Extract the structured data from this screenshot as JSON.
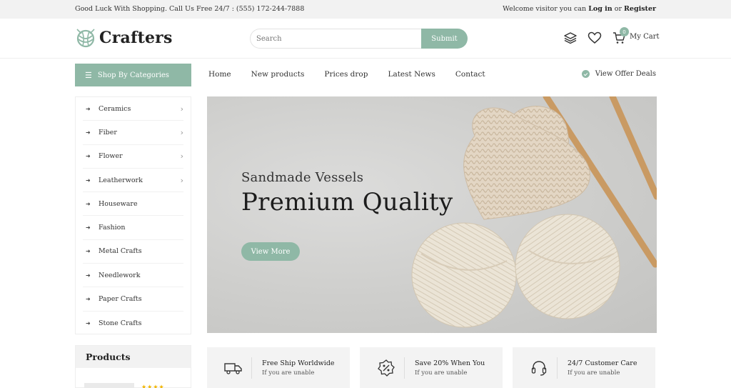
{
  "topbar": {
    "welcome_text": "Good Luck With Shopping. Call Us Free 24/7 : (555) 172-244-7888",
    "visitor_text": "Welcome visitor you can",
    "login_label": "Log in",
    "or_text": "or",
    "register_label": "Register"
  },
  "header": {
    "logo_text": "Crafters",
    "search_placeholder": "Search",
    "search_button": "Submit",
    "cart_count": "0",
    "cart_label": "My Cart"
  },
  "nav": {
    "categories_button": "Shop By Categories",
    "items": [
      "Home",
      "New products",
      "Prices drop",
      "Latest News",
      "Contact"
    ],
    "offer_label": "View Offer Deals"
  },
  "sidebar": {
    "categories": [
      {
        "label": "Ceramics",
        "has_submenu": true
      },
      {
        "label": "Fiber",
        "has_submenu": true
      },
      {
        "label": "Flower",
        "has_submenu": true
      },
      {
        "label": "Leatherwork",
        "has_submenu": true
      },
      {
        "label": "Houseware",
        "has_submenu": false
      },
      {
        "label": "Fashion",
        "has_submenu": false
      },
      {
        "label": "Metal Crafts",
        "has_submenu": false
      },
      {
        "label": "Needlework",
        "has_submenu": false
      },
      {
        "label": "Paper Crafts",
        "has_submenu": false
      },
      {
        "label": "Stone Crafts",
        "has_submenu": false
      }
    ]
  },
  "hero": {
    "subtitle": "Sandmade Vessels",
    "title": "Premium Quality",
    "button": "View More"
  },
  "products": {
    "heading": "Products",
    "stars": "★★★★"
  },
  "services": [
    {
      "icon": "truck-icon",
      "title": "Free Ship Worldwide",
      "desc": "If you are unable"
    },
    {
      "icon": "percent-badge-icon",
      "title": "Save 20% When You",
      "desc": "If you are unable"
    },
    {
      "icon": "headset-icon",
      "title": "24/7 Customer Care",
      "desc": "If you are unable"
    }
  ],
  "colors": {
    "accent": "#8fb8a6",
    "topbar_bg": "#f2f2f2",
    "text": "#222222"
  }
}
